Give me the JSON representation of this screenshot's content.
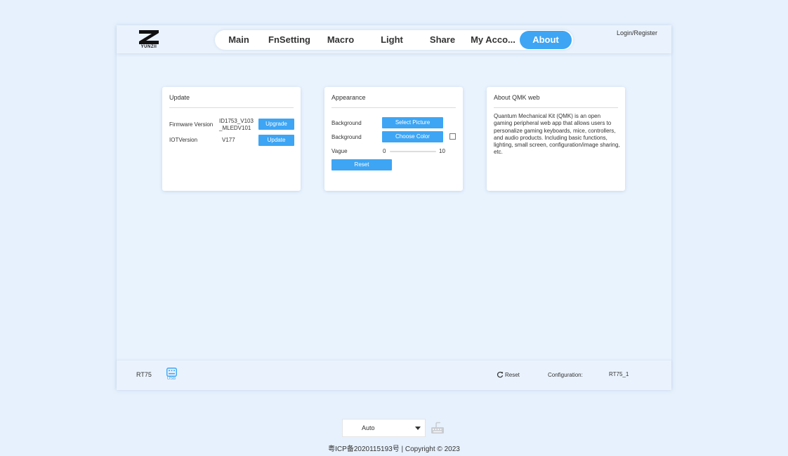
{
  "header": {
    "brand": "YUNZII",
    "nav": [
      {
        "label": "Main",
        "active": false
      },
      {
        "label": "FnSetting",
        "active": false
      },
      {
        "label": "Macro",
        "active": false
      },
      {
        "label": "Light",
        "active": false
      },
      {
        "label": "Share",
        "active": false
      },
      {
        "label": "My Acco...",
        "active": false
      },
      {
        "label": "About",
        "active": true
      }
    ],
    "login_label": "Login/Register"
  },
  "update_card": {
    "title": "Update",
    "firmware_label": "Firmware Version",
    "firmware_value": "ID1753_V103\n_MLEDV101",
    "firmware_value_line1": "ID1753_V103",
    "firmware_value_line2": "_MLEDV101",
    "upgrade_button": "Upgrade",
    "iot_label": "IOTVersion",
    "iot_value": "V177",
    "update_button": "Update"
  },
  "appearance_card": {
    "title": "Appearance",
    "background_label_1": "Background",
    "select_picture_button": "Select Picture",
    "background_label_2": "Background",
    "choose_color_button": "Choose Color",
    "vague_label": "Vague",
    "vague_min": "0",
    "vague_max": "10",
    "reset_button": "Reset"
  },
  "about_card": {
    "title": "About QMK web",
    "text": "Quantum Mechanical Kit (QMK) is an open gaming peripheral web app that allows users to personalize gaming keyboards, mice, controllers, and audio products. Including basic functions, lighting, small screen, configuration/image sharing, etc."
  },
  "footer_bar": {
    "model": "RT75",
    "connection": "USB",
    "reset_label": "Reset",
    "configuration_label": "Configuration:",
    "configuration_value": "RT75_1"
  },
  "bottom": {
    "mode_select": "Auto",
    "copyright": "粤ICP备2020115193号 | Copyright © 2023"
  },
  "colors": {
    "accent": "#3da5f4",
    "background": "#e7f1fd",
    "card": "#ffffff"
  }
}
